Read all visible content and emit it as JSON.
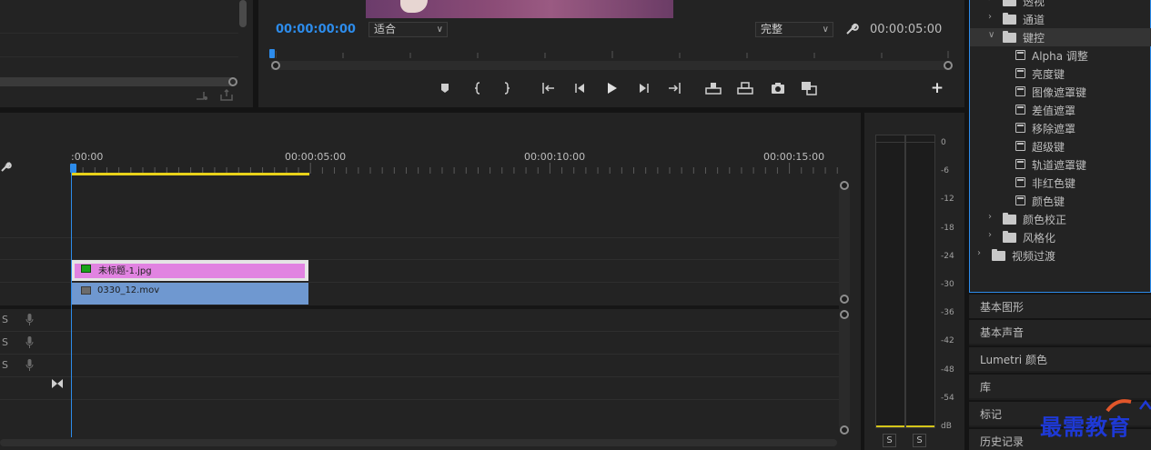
{
  "program_monitor": {
    "timecode": "00:00:00:00",
    "duration": "00:00:05:00",
    "fit_select": "适合",
    "quality_select": "完整",
    "transport": [
      "marker-icon",
      "mark-in-icon",
      "mark-out-icon",
      "go-to-in-icon",
      "step-back-icon",
      "play-icon",
      "step-forward-icon",
      "go-to-out-icon",
      "insert-icon",
      "overwrite-icon",
      "camera-icon",
      "compare-icon",
      "add-icon"
    ],
    "add_label": "+"
  },
  "timeline": {
    "ruler_labels": [
      ":00:00",
      "00:00:05:00",
      "00:00:10:00",
      "00:00:15:00"
    ],
    "clips": [
      {
        "name": "未标题-1.jpg",
        "color": "#e183e1"
      },
      {
        "name": "0330_12.mov",
        "color": "#6f98d0"
      }
    ],
    "audio_track_s": [
      "S",
      "S",
      "S"
    ]
  },
  "audio_meter": {
    "db_labels": [
      "0",
      "-6",
      "-12",
      "-18",
      "-24",
      "-30",
      "-36",
      "-42",
      "-48",
      "-54",
      "dB"
    ],
    "solo_buttons": [
      "S",
      "S"
    ]
  },
  "effects": {
    "items": [
      {
        "label": "透视",
        "level": 1,
        "type": "folder",
        "expanded": false
      },
      {
        "label": "通道",
        "level": 1,
        "type": "folder",
        "expanded": false
      },
      {
        "label": "键控",
        "level": 1,
        "type": "folder",
        "expanded": true,
        "selected": true
      },
      {
        "label": "Alpha 调整",
        "level": 2,
        "type": "effect"
      },
      {
        "label": "亮度键",
        "level": 2,
        "type": "effect"
      },
      {
        "label": "图像遮罩键",
        "level": 2,
        "type": "effect"
      },
      {
        "label": "差值遮罩",
        "level": 2,
        "type": "effect"
      },
      {
        "label": "移除遮罩",
        "level": 2,
        "type": "effect"
      },
      {
        "label": "超级键",
        "level": 2,
        "type": "effect"
      },
      {
        "label": "轨道遮罩键",
        "level": 2,
        "type": "effect"
      },
      {
        "label": "非红色键",
        "level": 2,
        "type": "effect"
      },
      {
        "label": "颜色键",
        "level": 2,
        "type": "effect"
      },
      {
        "label": "颜色校正",
        "level": 1,
        "type": "folder",
        "expanded": false
      },
      {
        "label": "风格化",
        "level": 1,
        "type": "folder",
        "expanded": false
      },
      {
        "label": "视频过渡",
        "level": 0,
        "type": "folder",
        "expanded": false
      }
    ]
  },
  "panels": [
    "基本图形",
    "基本声音",
    "Lumetri 颜色",
    "库",
    "标记",
    "历史记录"
  ],
  "watermark": {
    "text": "最需教育"
  },
  "colors": {
    "accent": "#2d8ceb",
    "work_area": "#e8d21a"
  }
}
